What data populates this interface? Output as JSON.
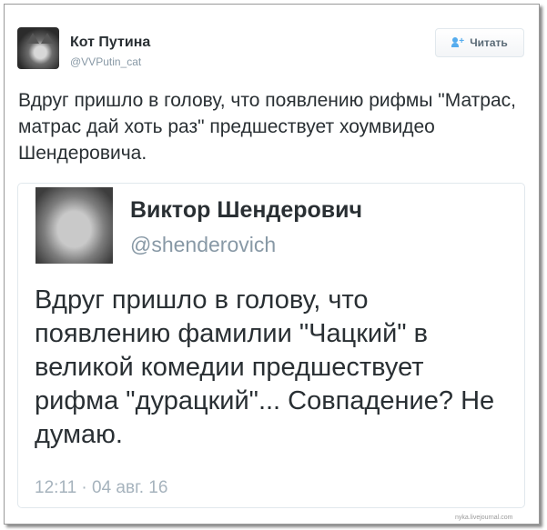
{
  "tweet": {
    "author_name": "Кот Путина",
    "author_handle": "@VVPutin_cat",
    "follow_label": "Читать",
    "text": "Вдруг пришло в голову, что появлению рифмы \"Матрас, матрас дай хоть раз\" предшествует хоумвидео Шендеровича."
  },
  "quoted": {
    "author_name": "Виктор Шендерович",
    "author_handle": "@shenderovich",
    "text": "Вдруг пришло в голову, что появлению фамилии \"Чацкий\" в великой комедии предшествует рифма \"дурацкий\"... Совпадение? Не думаю.",
    "timestamp": "12:11 · 04 авг. 16"
  },
  "watermark": "nyka.livejournal.com",
  "colors": {
    "text": "#292f33",
    "muted": "#8899a6",
    "accent": "#55acee",
    "border": "#e1e8ed"
  }
}
